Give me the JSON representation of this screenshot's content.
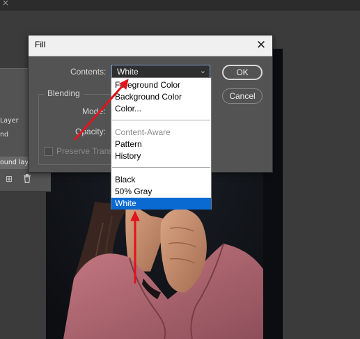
{
  "dialog": {
    "title": "Fill",
    "contents_label": "Contents:",
    "contents_value": "White",
    "blending_label": "Blending",
    "mode_label": "Mode:",
    "opacity_label": "Opacity:",
    "preserve_label": "Preserve Trans",
    "ok_label": "OK",
    "cancel_label": "Cancel"
  },
  "dropdown": {
    "items": [
      {
        "label": "Foreground Color",
        "state": "normal"
      },
      {
        "label": "Background Color",
        "state": "normal"
      },
      {
        "label": "Color...",
        "state": "normal"
      },
      {
        "label": "Content-Aware",
        "state": "disabled"
      },
      {
        "label": "Pattern",
        "state": "normal"
      },
      {
        "label": "History",
        "state": "normal"
      },
      {
        "label": "Black",
        "state": "normal"
      },
      {
        "label": "50% Gray",
        "state": "normal"
      },
      {
        "label": "White",
        "state": "selected"
      }
    ]
  },
  "layers_panel": {
    "row1": "Layer",
    "row2": "nd",
    "row3": "ound laye",
    "new_layer_icon": "plus-square-icon",
    "delete_icon": "trash-icon"
  },
  "colors": {
    "panel": "#535353",
    "selection": "#0a6ad2",
    "annotation_arrow": "#e0141c"
  }
}
